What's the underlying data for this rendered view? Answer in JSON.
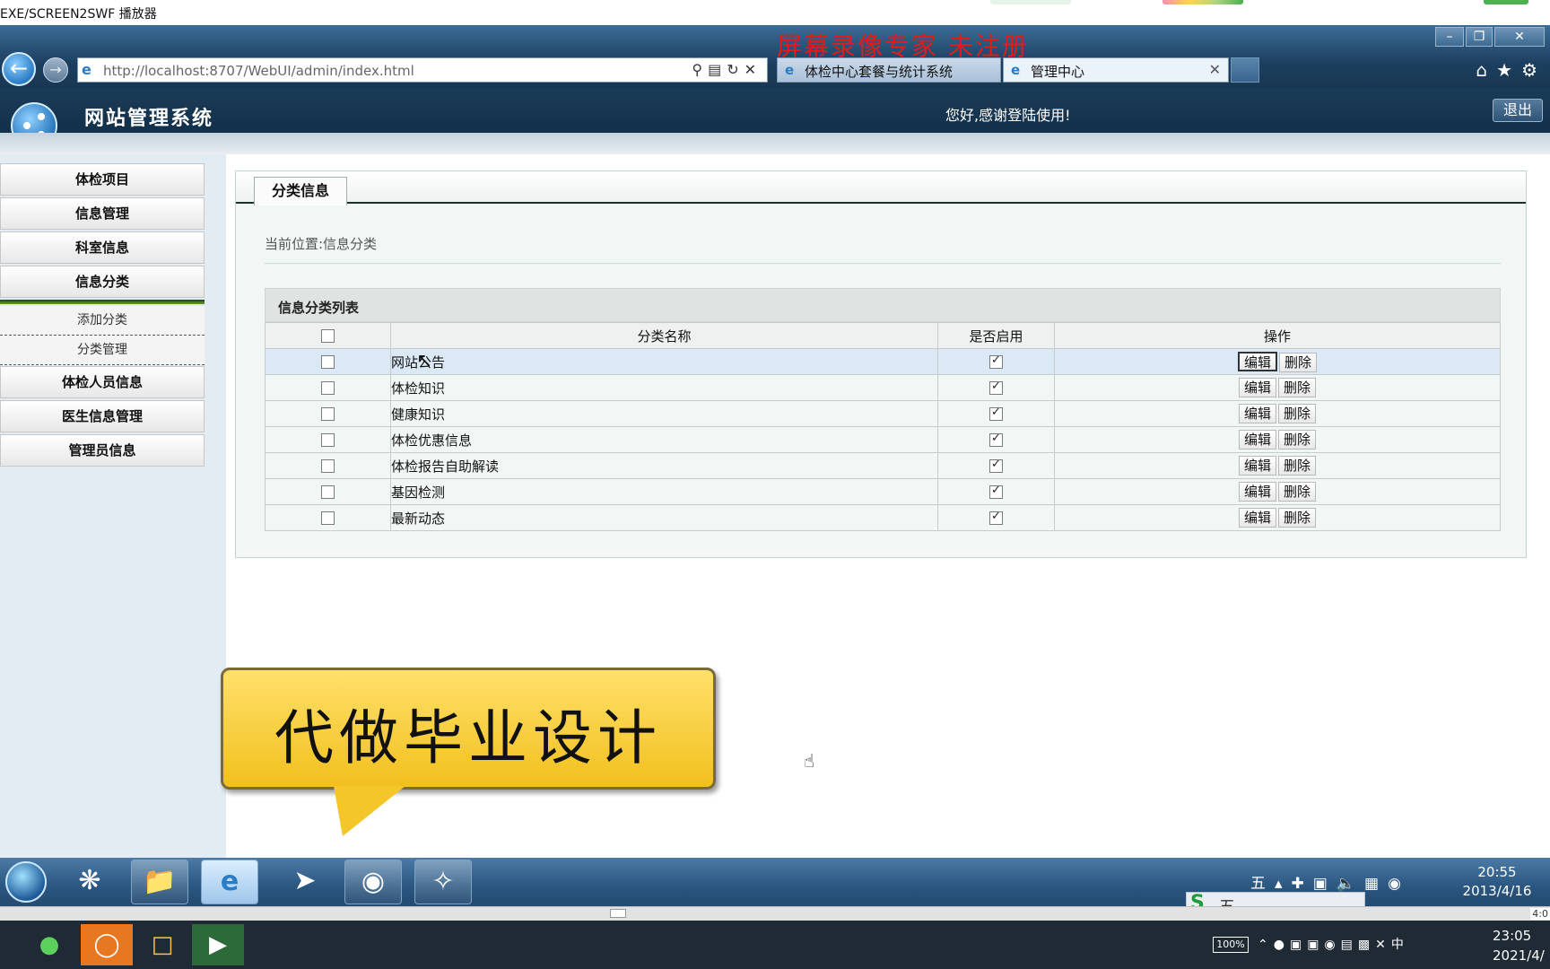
{
  "player": {
    "title": "EXE/SCREEN2SWF 播放器",
    "watermark": "屏幕录像专家 未注册",
    "time_display": "4:0"
  },
  "browser": {
    "url": "http://localhost:8707/WebUI/admin/index.html",
    "tabs": [
      {
        "label": "体检中心套餐与统计系统"
      },
      {
        "label": "管理中心",
        "active": true
      }
    ]
  },
  "app": {
    "title": "网站管理系统",
    "welcome": "您好,感谢登陆使用!",
    "logout_label": "退出"
  },
  "sidebar": {
    "items": [
      {
        "label": "体检项目"
      },
      {
        "label": "信息管理"
      },
      {
        "label": "科室信息"
      },
      {
        "label": "信息分类",
        "expanded": true
      },
      {
        "label": "体检人员信息"
      },
      {
        "label": "医生信息管理"
      },
      {
        "label": "管理员信息"
      }
    ],
    "sub_items": [
      {
        "label": "添加分类"
      },
      {
        "label": "分类管理"
      }
    ]
  },
  "panel": {
    "tab_label": "分类信息",
    "breadcrumb": "当前位置:信息分类",
    "list_title": "信息分类列表",
    "columns": {
      "name": "分类名称",
      "enabled": "是否启用",
      "actions": "操作"
    },
    "edit_label": "编辑",
    "delete_label": "删除",
    "rows": [
      {
        "name": "网站公告",
        "enabled": true
      },
      {
        "name": "体检知识",
        "enabled": true
      },
      {
        "name": "健康知识",
        "enabled": true
      },
      {
        "name": "体检优惠信息",
        "enabled": true
      },
      {
        "name": "体检报告自助解读",
        "enabled": true
      },
      {
        "name": "基因检测",
        "enabled": true
      },
      {
        "name": "最新动态",
        "enabled": true
      }
    ]
  },
  "ad": {
    "text": "代做毕业设计"
  },
  "inner_taskbar": {
    "clock_time": "20:55",
    "clock_date": "2013/4/16",
    "ime": "五"
  },
  "host_taskbar": {
    "battery": "100%",
    "ime": "中",
    "clock_time": "23:05",
    "clock_date": "2021/4/"
  },
  "colors": {
    "header_bg": "#12304a",
    "panel_bg": "#f1f7f5",
    "highlight_row": "#dbe8f6",
    "watermark": "#e01b1b",
    "ad_yellow": "#f2c01e"
  }
}
